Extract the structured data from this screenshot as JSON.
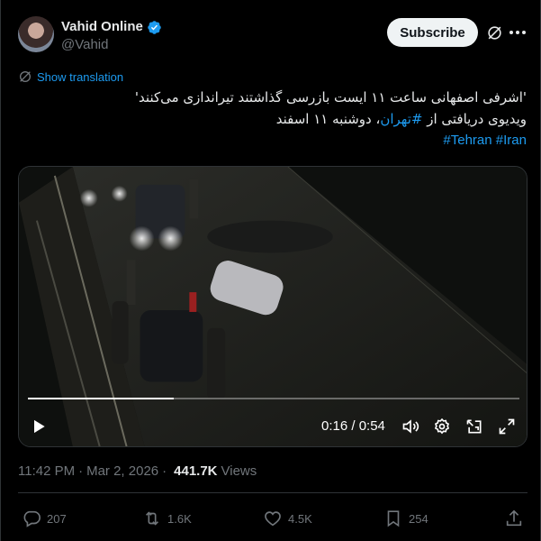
{
  "author": {
    "display_name": "Vahid Online",
    "handle": "@Vahid",
    "verified": true
  },
  "header": {
    "subscribe_label": "Subscribe"
  },
  "translation": {
    "link_label": "Show translation"
  },
  "tweet": {
    "line1": "'اشرفی اصفهانی ساعت ۱۱ ایست بازرسی گذاشتند تیراندازی می‌کنند'",
    "line2_prefix": "ویدیوی دریافتی از ",
    "line2_hashtag": "#تهران",
    "line2_suffix": "، دوشنبه ۱۱ اسفند",
    "hashtags": [
      "#Tehran",
      "#Iran"
    ]
  },
  "video": {
    "time_display": "0:16 / 0:54",
    "progress_fraction": 0.296
  },
  "meta": {
    "time": "11:42 PM",
    "date": "Mar 2, 2026",
    "views_count": "441.7K",
    "views_label": "Views",
    "separator": "·"
  },
  "actions": {
    "replies": "207",
    "reposts": "1.6K",
    "likes": "4.5K",
    "bookmarks": "254"
  },
  "colors": {
    "accent": "#1d9bf0",
    "background": "#000000",
    "muted": "#71767b",
    "text": "#e7e9ea"
  }
}
